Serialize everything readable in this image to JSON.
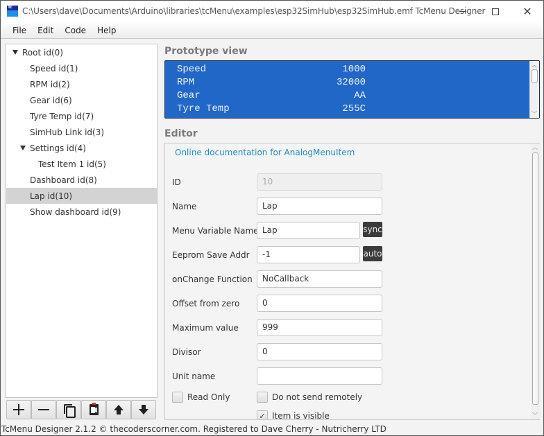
{
  "window": {
    "title": "C:\\Users\\dave\\Documents\\Arduino\\libraries\\tcMenu\\examples\\esp32SimHub\\esp32SimHub.emf TcMenu Designer",
    "app_icon_text": "Tc",
    "controls": {
      "minimize": "minimize",
      "maximize": "maximize",
      "close": "✕"
    }
  },
  "menubar": {
    "items": [
      "File",
      "Edit",
      "Code",
      "Help"
    ]
  },
  "tree": {
    "items": [
      {
        "label": "Root id(0)",
        "level": 0,
        "expanded": true,
        "selected": false
      },
      {
        "label": "Speed id(1)",
        "level": 1,
        "selected": false
      },
      {
        "label": "RPM id(2)",
        "level": 1,
        "selected": false
      },
      {
        "label": "Gear id(6)",
        "level": 1,
        "selected": false
      },
      {
        "label": "Tyre Temp id(7)",
        "level": 1,
        "selected": false
      },
      {
        "label": "SimHub Link id(3)",
        "level": 1,
        "selected": false
      },
      {
        "label": "Settings id(4)",
        "level": 1,
        "expanded": true,
        "selected": false
      },
      {
        "label": "Test Item 1 id(5)",
        "level": 2,
        "selected": false
      },
      {
        "label": "Dashboard id(8)",
        "level": 1,
        "selected": false
      },
      {
        "label": "Lap id(10)",
        "level": 1,
        "selected": true
      },
      {
        "label": "Show dashboard id(9)",
        "level": 1,
        "selected": false
      }
    ],
    "toolbar": [
      {
        "name": "add-item-button",
        "icon": "plus-icon"
      },
      {
        "name": "remove-item-button",
        "icon": "minus-icon"
      },
      {
        "name": "copy-item-button",
        "icon": "copy-icon"
      },
      {
        "name": "paste-item-button",
        "icon": "paste-icon"
      },
      {
        "name": "move-up-button",
        "icon": "arrow-up-icon"
      },
      {
        "name": "move-down-button",
        "icon": "arrow-down-icon"
      }
    ]
  },
  "prototype": {
    "title": "Prototype view",
    "rows": [
      {
        "name": "Speed",
        "value": "1000"
      },
      {
        "name": "RPM",
        "value": "32000"
      },
      {
        "name": "Gear",
        "value": "AA"
      },
      {
        "name": "Tyre Temp",
        "value": "255C"
      }
    ],
    "colors": {
      "background": "#2067c8",
      "text": "#f2f2f2"
    }
  },
  "editor": {
    "title": "Editor",
    "doc_link": "Online documentation for AnalogMenuItem",
    "fields": {
      "id": {
        "label": "ID",
        "value": "10",
        "disabled": true
      },
      "name": {
        "label": "Name",
        "value": "Lap"
      },
      "variable_name": {
        "label": "Menu Variable Name",
        "value": "Lap",
        "button": "sync"
      },
      "eeprom": {
        "label": "Eeprom Save Addr",
        "value": "-1",
        "button": "auto"
      },
      "on_change": {
        "label": "onChange Function",
        "value": "NoCallback"
      },
      "offset": {
        "label": "Offset from zero",
        "value": "0"
      },
      "max_value": {
        "label": "Maximum value",
        "value": "999"
      },
      "divisor": {
        "label": "Divisor",
        "value": "0"
      },
      "unit_name": {
        "label": "Unit name",
        "value": ""
      }
    },
    "checkboxes": {
      "read_only": {
        "label": "Read Only",
        "checked": false
      },
      "no_remote": {
        "label": "Do not send remotely",
        "checked": false
      },
      "visible": {
        "label": "Item is visible",
        "checked": true
      }
    },
    "link_color": "#1b8ec8"
  },
  "status_bar": {
    "text": "TcMenu Designer 2.1.2 © thecoderscorner.com. Registered to Dave Cherry - Nutricherry LTD"
  }
}
